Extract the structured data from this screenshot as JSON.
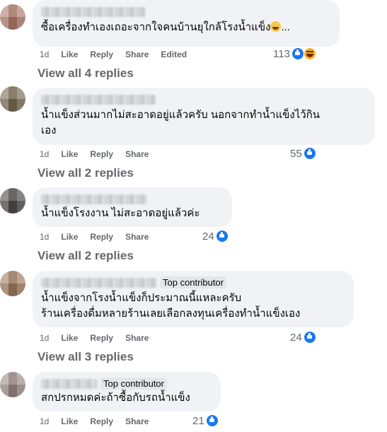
{
  "comments": [
    {
      "avatar_color": "#b07a6a",
      "text": "ซื้อเครื่องทำเองเถอะจากใจคนบ้านยุใกล้โรงน้ำแข็ง",
      "ellipsis": "...",
      "time": "1d",
      "like": "Like",
      "reply": "Reply",
      "share": "Share",
      "edited": "Edited",
      "reactions": "113",
      "reaction_icons": [
        "like-icon",
        "haha-icon"
      ],
      "view_replies": "View all 4 replies"
    },
    {
      "avatar_color": "#7a6a52",
      "text_line1": "น้ำแข็งส่วนมากไม่สะอาดอยู่แล้วครับ นอกจากทำน้ำแข็งไว้กิน",
      "text_line2": "เอง",
      "time": "1d",
      "like": "Like",
      "reply": "Reply",
      "share": "Share",
      "reactions": "55",
      "view_replies": "View all 2 replies"
    },
    {
      "avatar_color": "#4e4a48",
      "text": "น้ำแข็งโรงงาน ไม่สะอาดอยู่แล้วค่ะ",
      "time": "1d",
      "like": "Like",
      "reply": "Reply",
      "share": "Share",
      "reactions": "24",
      "view_replies": "View all 2 replies"
    },
    {
      "avatar_color": "#a07a5e",
      "badge": "Top contributor",
      "text_line1": "น้ำแข็งจากโรงน้ำแข็งก็ประมาณนี้แหละครับ",
      "text_line2": "ร้านเครื่องดื่มหลายร้านเลยเลือกลงทุนเครื่องทำน้ำแข็งเอง",
      "time": "1d",
      "like": "Like",
      "reply": "Reply",
      "share": "Share",
      "reactions": "24",
      "view_replies": "View all 3 replies"
    },
    {
      "avatar_color": "#9a8a84",
      "badge": "Top contributor",
      "text": "สกปรกหมดค่ะถ้าซื้อกับรถน้ำแข็ง",
      "time": "1d",
      "like": "Like",
      "reply": "Reply",
      "share": "Share",
      "reactions": "21"
    }
  ]
}
